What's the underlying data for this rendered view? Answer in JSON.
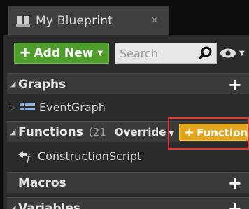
{
  "tab": {
    "title": "My Blueprint",
    "close": "×"
  },
  "toolbar": {
    "add_new_label": "Add New",
    "search_placeholder": "Search"
  },
  "sections": {
    "graphs": {
      "label": "Graphs",
      "items": [
        "EventGraph"
      ]
    },
    "functions": {
      "label": "Functions",
      "count": "(21",
      "override_label": "Override",
      "add_function_label": "Function",
      "items": [
        "ConstructionScript"
      ]
    },
    "macros": {
      "label": "Macros"
    },
    "variables": {
      "label": "Variables"
    }
  },
  "colors": {
    "add_new": "#4f9e2c",
    "function_button": "#e3a51c",
    "highlight": "#e03a3a"
  }
}
